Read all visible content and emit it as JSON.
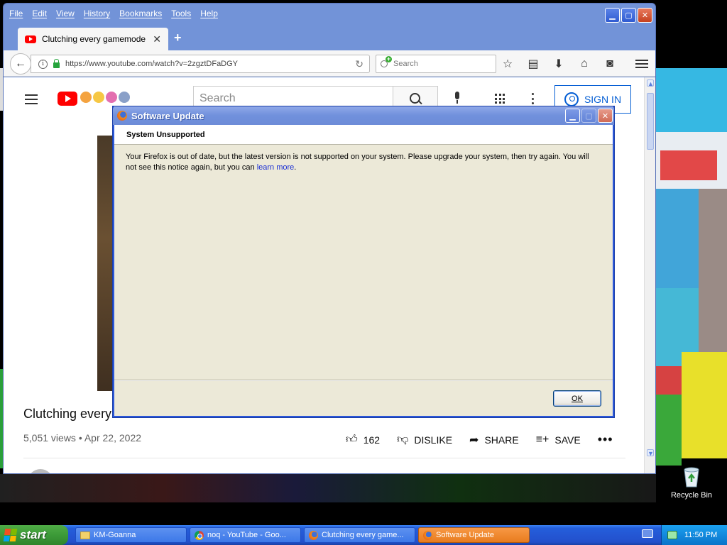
{
  "browser": {
    "menu": [
      "File",
      "Edit",
      "View",
      "History",
      "Bookmarks",
      "Tools",
      "Help"
    ],
    "tab_title": "Clutching every gamemode in...",
    "url": "https://www.youtube.com/watch?v=2zgztDFaDGY",
    "search_placeholder": "Search"
  },
  "youtube": {
    "search_placeholder": "Search",
    "sign_in": "SIGN IN",
    "video_title": "Clutching every",
    "meta": "5,051 views • Apr 22, 2022",
    "likes": "162",
    "dislike": "DISLIKE",
    "share": "SHARE",
    "save": "SAVE",
    "more": "•••"
  },
  "dialog": {
    "title": "Software Update",
    "header": "System Unsupported",
    "body": "Your Firefox is out of date, but the latest version is not supported on your system. Please upgrade your system, then try again. You will not see this notice again, but you can",
    "link": "learn more",
    "trailing": ".",
    "ok": "OK"
  },
  "taskbar": {
    "start": "start",
    "tasks": [
      "KM-Goanna",
      "noq - YouTube - Goo...",
      "Clutching every game...",
      "Software Update"
    ],
    "clock": "11:50 PM"
  },
  "desktop": {
    "recycle_bin": "Recycle Bin"
  }
}
